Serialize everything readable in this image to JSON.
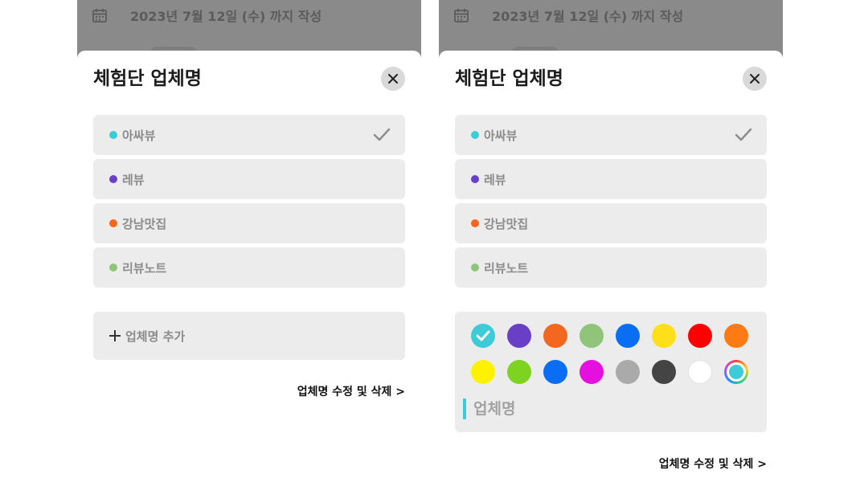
{
  "background": {
    "deadline_text": "2023년 7월 12일 (수) 까지 작성",
    "calendar_icon": "calendar-icon"
  },
  "sheet": {
    "title": "체험단 업체명",
    "close_icon": "close-icon"
  },
  "vendors": [
    {
      "label": "아싸뷰",
      "color": "#3ecbd8",
      "selected": true
    },
    {
      "label": "레뷰",
      "color": "#6a3fc7",
      "selected": false
    },
    {
      "label": "강남맛집",
      "color": "#f4671f",
      "selected": false
    },
    {
      "label": "리뷰노트",
      "color": "#8fc47a",
      "selected": false
    }
  ],
  "add_vendor_label": "업체명 추가",
  "edit_link": "업체명 수정 및 삭제 >",
  "palette": {
    "selected_color": "#3ecbd8",
    "colors": [
      "#3ecbd8",
      "#6a3fc7",
      "#f4671f",
      "#8fc47a",
      "#0a6ef5",
      "#ffdf1a",
      "#ff0000",
      "#ff7a12",
      "#fff200",
      "#7ed321",
      "#0a6ef5",
      "#e510e0",
      "#aaaaaa",
      "#444444",
      "#ffffff",
      "custom"
    ]
  },
  "name_input": {
    "placeholder": "업체명",
    "value": ""
  }
}
